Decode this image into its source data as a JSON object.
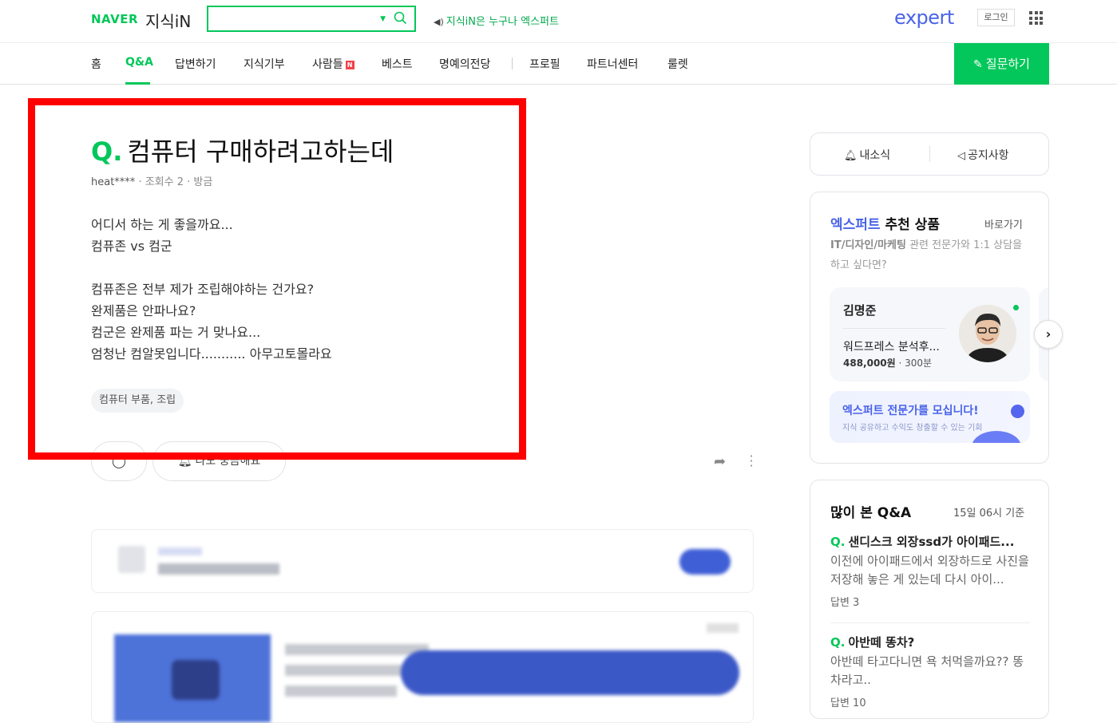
{
  "header": {
    "brand": "NAVER",
    "service": "지식iN",
    "search_placeholder": "",
    "notice": "지식iN은 누구나 엑스퍼트",
    "expert_logo": "expert",
    "login": "로그인"
  },
  "nav": {
    "items": [
      "홈",
      "Q&A",
      "답변하기",
      "지식기부",
      "사람들",
      "베스트",
      "명예의전당",
      "프로필",
      "파트너센터",
      "룰렛"
    ],
    "badge": "N",
    "ask_button": "질문하기"
  },
  "question": {
    "q_mark": "Q.",
    "title": "컴퓨터 구매하려고하는데",
    "user": "heat****",
    "views": "조회수 2",
    "time": "방금",
    "body_lines": [
      "어디서 하는 게 좋을까요...",
      "컴퓨존 vs 컴군",
      "",
      "컴퓨존은 전부 제가 조립해야하는 건가요?",
      "완제품은 안파나요?",
      "컴군은 완제품 파는 거 맞나요...",
      "엄청난 컴알못입니다........... 아무고토몰라요"
    ],
    "tag": "컴퓨터 부품, 조립",
    "notify_button": "나도 궁금해요"
  },
  "sidebar": {
    "my_news": "내소식",
    "announcements": "공지사항",
    "expert": {
      "title_blue": "엑스퍼트",
      "title_rest": " 추천 상품",
      "goto": "바로가기",
      "desc_bold": "IT/디자인/마케팅",
      "desc_rest": " 관련 전문가와 1:1 상담을 하고 싶다면?",
      "card": {
        "name": "김명준",
        "product": "워드프레스 분석후...",
        "price": "488,000원",
        "duration": "300분"
      },
      "banner_title": "엑스퍼트 전문가를 모십니다!",
      "banner_sub": "지식 공유하고 수익도 창출할 수 있는 기회"
    },
    "popular": {
      "title": "많이 본 Q&A",
      "time": "15일 06시 기준",
      "items": [
        {
          "title": "샌디스크 외장ssd가 아이패드...",
          "body": "이전에 아이패드에서 외장하드로 사진을 저장해 놓은 게 있는데 다시 아이...",
          "answers": "답변 3"
        },
        {
          "title": "아반떼 똥차?",
          "body": "아반떼 타고다니면 욕 처먹을까요?? 똥차라고..",
          "answers": "답변 10"
        }
      ]
    }
  },
  "colors": {
    "accent_green": "#03c75a",
    "expert_blue": "#4a63e8",
    "highlight_red": "#ff0000"
  }
}
